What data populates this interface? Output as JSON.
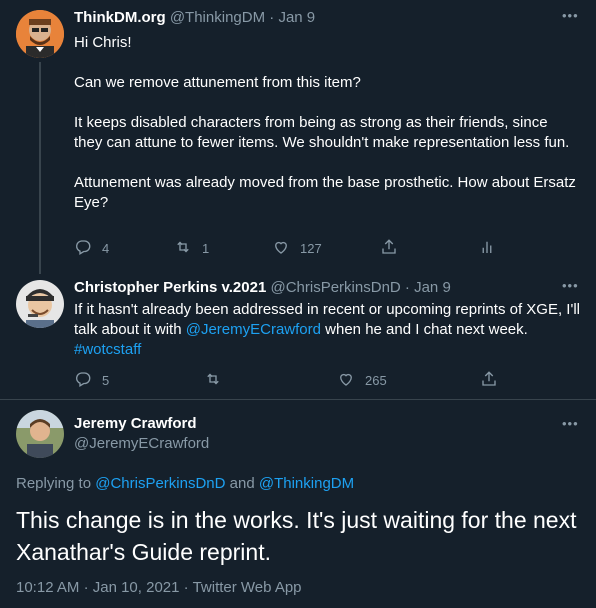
{
  "tweet1": {
    "display_name": "ThinkDM.org",
    "handle": "@ThinkingDM",
    "separator": "·",
    "date": "Jan 9",
    "paragraphs": [
      "Hi Chris!",
      "Can we remove attunement from this item?",
      "It keeps disabled characters from being as strong as their friends, since they can attune to fewer items. We shouldn't make representation less fun.",
      "Attunement was already moved from the base prosthetic. How about Ersatz Eye?"
    ],
    "replies": "4",
    "retweets": "1",
    "likes": "127"
  },
  "tweet2": {
    "display_name": "Christopher Perkins v.2021",
    "handle": "@ChrisPerkinsDnD",
    "separator": "·",
    "date": "Jan 9",
    "text_before": "If it hasn't already been addressed in recent or upcoming reprints of XGE, I'll talk about it with ",
    "mention": "@JeremyECrawford",
    "text_after": " when he and I chat next week.",
    "hashtag": "#wotcstaff",
    "replies": "5",
    "retweets": "",
    "likes": "265"
  },
  "tweet3": {
    "display_name": "Jeremy Crawford",
    "handle": "@JeremyECrawford",
    "replying_prefix": "Replying to",
    "replying_user1": "@ChrisPerkinsDnD",
    "replying_and": "and",
    "replying_user2": "@ThinkingDM",
    "text": "This change is in the works. It's just waiting for the next Xanathar's Guide reprint.",
    "time": "10:12 AM",
    "date": "Jan 10, 2021",
    "source": "Twitter Web App",
    "separator": "·"
  },
  "icons": {
    "more": "more-icon",
    "reply": "reply-icon",
    "retweet": "retweet-icon",
    "like": "heart-icon",
    "share": "share-icon",
    "analytics": "analytics-icon"
  },
  "colors": {
    "background": "#15202b",
    "muted": "#8899a6",
    "link": "#1da1f2",
    "divider": "#38444d"
  }
}
